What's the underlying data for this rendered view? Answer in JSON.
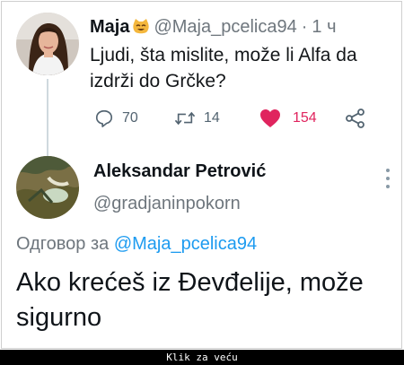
{
  "tweet": {
    "author_name": "Maja",
    "author_emoji": "cat-emoji",
    "author_handle": "@Maja_pcelica94",
    "separator": "·",
    "time": "1 ч",
    "text": "Ljudi, šta mislite, može li Alfa da izdrži do Grčke?",
    "replies_count": "70",
    "retweets_count": "14",
    "likes_count": "154",
    "like_color": "#e0245e"
  },
  "reply": {
    "author_name": "Aleksandar Petrović",
    "author_handle": "@gradjaninpokorn",
    "replying_label": "Одговор за",
    "replying_to": "@Maja_pcelica94",
    "text": "Ako krećeš iz Đevđelije, može sigurno"
  },
  "footer": {
    "link_label": "Klik za veću"
  },
  "colors": {
    "accent": "#1d9bf0",
    "secondary_text": "#6e767d",
    "like": "#e0245e"
  }
}
